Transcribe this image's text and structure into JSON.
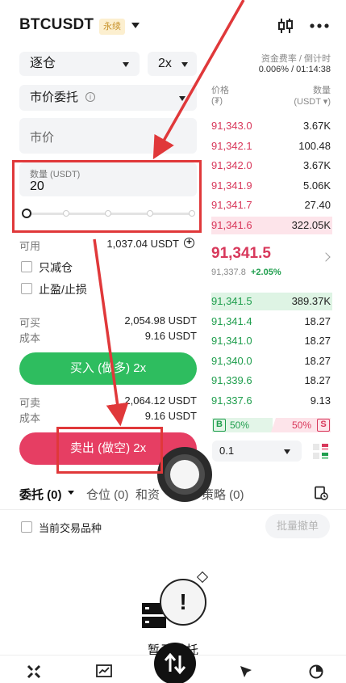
{
  "header": {
    "pair": "BTCUSDT",
    "badge": "永续"
  },
  "form": {
    "margin_mode": "逐仓",
    "leverage": "2x",
    "order_type": "市价委托",
    "price_placeholder": "市价",
    "qty_label": "数量 (USDT)",
    "qty_value": "20",
    "slider_percent": 0,
    "available_label": "可用",
    "available_value": "1,037.04 USDT",
    "reduce_only": "只减仓",
    "tp_sl": "止盈/止损",
    "can_buy_label": "可买",
    "can_buy_value": "2,054.98 USDT",
    "cost_label_1": "成本",
    "cost_value_1": "9.16 USDT",
    "buy_button": "买入 (做多) 2x",
    "can_sell_label": "可卖",
    "can_sell_value": "2,064.12 USDT",
    "cost_label_2": "成本",
    "cost_value_2": "9.16 USDT",
    "sell_button": "卖出 (做空) 2x"
  },
  "orderbook": {
    "funding_label": "资金费率 / 倒计时",
    "funding_value": "0.006% / 01:14:38",
    "col_price": "价格",
    "col_price_unit": "(₮)",
    "col_qty": "数量",
    "col_qty_unit": "(USDT ▾)",
    "asks": [
      {
        "price": "91,343.0",
        "qty": "3.67K"
      },
      {
        "price": "91,342.1",
        "qty": "100.48"
      },
      {
        "price": "91,342.0",
        "qty": "3.67K"
      },
      {
        "price": "91,341.9",
        "qty": "5.06K"
      },
      {
        "price": "91,341.7",
        "qty": "27.40"
      },
      {
        "price": "91,341.6",
        "qty": "322.05K"
      }
    ],
    "last_price": "91,341.5",
    "mark_price": "91,337.8",
    "change": "+2.05%",
    "bids": [
      {
        "price": "91,341.5",
        "qty": "389.37K"
      },
      {
        "price": "91,341.4",
        "qty": "18.27"
      },
      {
        "price": "91,341.0",
        "qty": "18.27"
      },
      {
        "price": "91,340.0",
        "qty": "18.27"
      },
      {
        "price": "91,339.6",
        "qty": "18.27"
      },
      {
        "price": "91,337.6",
        "qty": "9.13"
      }
    ],
    "buy_tag": "B",
    "buy_pct": "50%",
    "sell_pct": "50%",
    "sell_tag": "S",
    "depth_step": "0.1"
  },
  "tabs": {
    "orders": "委托 (0)",
    "positions": "仓位 (0)",
    "assets": "和资",
    "strategy": "策略 (0)"
  },
  "filter": {
    "current_symbol": "当前交易品种",
    "cancel_all": "批量撤单"
  },
  "empty": {
    "text": "暂无委托"
  }
}
